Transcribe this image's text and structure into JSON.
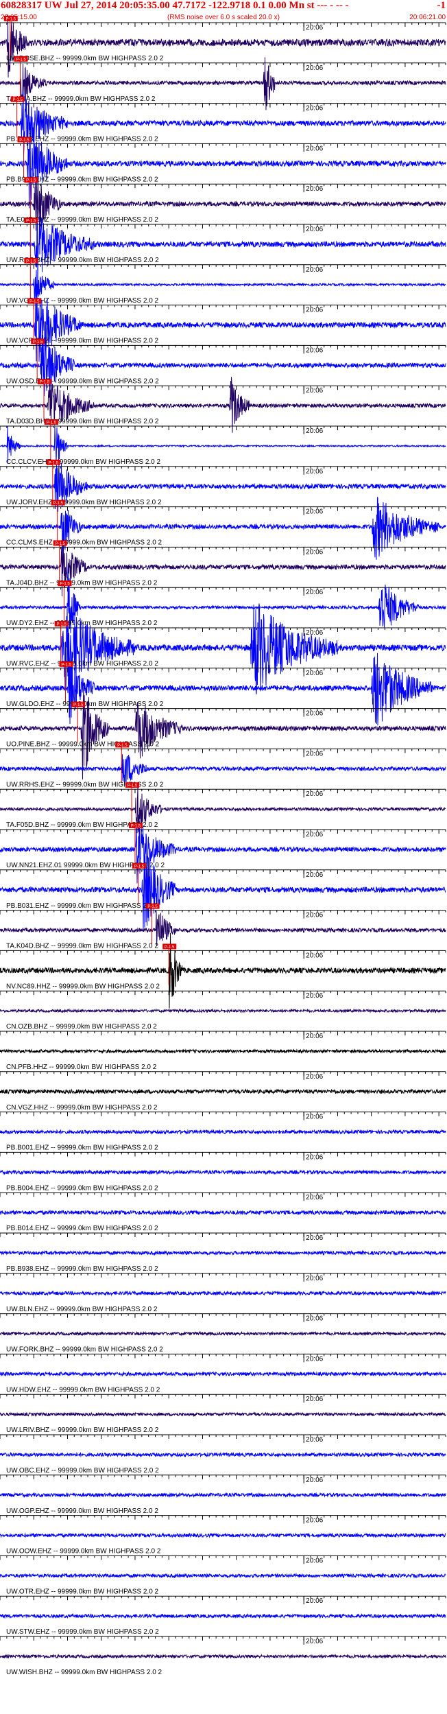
{
  "header": {
    "title": "60828317 UW Jul 27, 2014 20:05:35.00   47.7172 -122.9718  0.1 0.00 Mn st --- - -- -",
    "right": "-1",
    "start_time": "20:05:15.00",
    "note": "(RMS noise over 6.0 s scaled 20.0 x)",
    "end_time": "20:06:21.00"
  },
  "colors": {
    "header": "#e00000",
    "blue": "#0000ff",
    "navy": "#200060",
    "black": "#000000",
    "pick": "#e00000"
  },
  "chart_data": {
    "type": "seismogram",
    "x_start": "20:05:15.00",
    "x_end": "20:06:21.00",
    "x_range_s": [
      0,
      66
    ],
    "minute_marker_label": "20:06",
    "minute_marker_s": 45,
    "tick_interval_s": 1,
    "traces": [
      {
        "label": "UW.DOSE.BHZ -- 99999.0km BW  HIGHPASS  2.0  2",
        "color": "navy",
        "amp": 0.9,
        "pick_s": 1.5,
        "pick_label": "P-1.5",
        "burst": [
          1,
          4,
          1.1
        ]
      },
      {
        "label": "TA.I04A.BHZ -- 99999.0km BW  HIGHPASS  2.0  2",
        "color": "navy",
        "amp": 0.5,
        "pick_s": 3.0,
        "pick_label": "P-1.5",
        "burst": [
          3,
          7,
          0.6
        ],
        "burst2": [
          39,
          41,
          1.3
        ]
      },
      {
        "label": "PB.B013.EHZ -- 99999.0km BW  HIGHPASS  2.0  2",
        "color": "blue",
        "amp": 0.7,
        "pick_s": 2.5,
        "pick_label": "P-1.5",
        "burst": [
          3,
          10,
          1.0
        ]
      },
      {
        "label": "PB.B943.EHZ -- 99999.0km BW  HIGHPASS  2.0  2",
        "color": "blue",
        "amp": 0.7,
        "pick_s": 3.5,
        "pick_label": "P-1.5",
        "burst": [
          4,
          10,
          1.3
        ]
      },
      {
        "label": "TA.E04D.BHZ -- 99999.0km BW  HIGHPASS  2.0  2",
        "color": "navy",
        "amp": 0.6,
        "pick_s": 4.5,
        "pick_label": "P-1.5",
        "burst": [
          5,
          9,
          1.1
        ]
      },
      {
        "label": "UW.RGS.BHZ -- 99999.0km BW  HIGHPASS  2.0  2",
        "color": "blue",
        "amp": 0.7,
        "pick_s": 4.5,
        "pick_label": "P-1.5",
        "burst": [
          5,
          14,
          1.0
        ]
      },
      {
        "label": "UW.VGB.BHZ -- 99999.0km BW  HIGHPASS  2.0  2",
        "color": "blue",
        "amp": 0.3,
        "pick_s": 4.5,
        "pick_label": "P-1.5",
        "burst": [
          5,
          8,
          0.8
        ]
      },
      {
        "label": "UW.VCR.BHZ -- 99999.0km BW  HIGHPASS  2.0  2",
        "color": "blue",
        "amp": 0.7,
        "pick_s": 5.0,
        "pick_label": "P-1.5",
        "burst": [
          5,
          12,
          1.3
        ]
      },
      {
        "label": "UW.OSD.EHZ -- 99999.0km BW  HIGHPASS  2.0  2",
        "color": "blue",
        "amp": 0.6,
        "pick_s": 5.5,
        "pick_label": "P-1.5",
        "burst": [
          6,
          11,
          1.3
        ]
      },
      {
        "label": "TA.D03D.BHZ -- 99999.0km BW  HIGHPASS  2.0  2",
        "color": "navy",
        "amp": 0.5,
        "pick_s": 6.5,
        "pick_label": "P-1.5",
        "burst": [
          7,
          14,
          0.9
        ],
        "burst2": [
          34,
          37,
          1.0
        ]
      },
      {
        "label": "CC.CLCV.EHZ -- 99999.0km BW  HIGHPASS  2.0  2",
        "color": "blue",
        "amp": 0.2,
        "pick_s": 7.5,
        "pick_label": "P-1.5",
        "burst": [
          8,
          10,
          0.9
        ],
        "burst2": [
          1,
          3,
          0.6
        ]
      },
      {
        "label": "UW.JORV.EHZ -- 99999.0km BW  HIGHPASS  2.0  2",
        "color": "blue",
        "amp": 0.6,
        "pick_s": 7.8,
        "pick_label": "P-1.5",
        "burst": [
          8,
          13,
          1.0
        ]
      },
      {
        "label": "CC.CLMS.EHZ -- 99999.0km BW  HIGHPASS  2.0  2",
        "color": "blue",
        "amp": 0.6,
        "pick_s": 8.5,
        "pick_label": "P-1.5",
        "burst": [
          9,
          12,
          1.0
        ],
        "burst2": [
          55,
          65,
          1.0
        ]
      },
      {
        "label": "TA.J04D.BHZ -- 99999.0km BW  HIGHPASS  2.0  2",
        "color": "navy",
        "amp": 0.6,
        "pick_s": 8.8,
        "pick_label": "P-1.5",
        "burst": [
          9,
          13,
          0.9
        ]
      },
      {
        "label": "UW.DY2.EHZ -- 99999.0km BW  HIGHPASS  2.0  2",
        "color": "blue",
        "amp": 0.4,
        "pick_s": 9.5,
        "pick_label": "P-1.5",
        "burst": [
          10,
          12,
          1.2
        ],
        "burst2": [
          56,
          62,
          1.0
        ]
      },
      {
        "label": "UW.RVC.EHZ -- 99999.0km BW  HIGHPASS  2.0  2",
        "color": "blue",
        "amp": 0.8,
        "pick_s": 9.0,
        "pick_label": "P-1.5",
        "burst": [
          9,
          20,
          1.4
        ],
        "burst2": [
          37,
          50,
          1.5
        ]
      },
      {
        "label": "UW.GLDO.EHZ -- 99999.0km BW  HIGHPASS  2.0  2",
        "color": "blue",
        "amp": 0.7,
        "pick_s": 9.7,
        "pick_label": "P-1.5",
        "burst": [
          10,
          14,
          1.1
        ],
        "burst2": [
          55,
          64,
          1.3
        ]
      },
      {
        "label": "UO.PINE.BHZ -- 99999.0km BW  HIGHPASS  2.0  2",
        "color": "navy",
        "amp": 0.6,
        "pick_s": 11.5,
        "pick_label": "P-1.5",
        "burst": [
          12,
          16,
          1.6
        ],
        "burst2": [
          20,
          27,
          1.0
        ]
      },
      {
        "label": "UW.RRHS.EHZ -- 99999.0km BW  HIGHPASS  2.0  2",
        "color": "blue",
        "amp": 0.5,
        "pick_s": 18.0,
        "pick_label": "P-1.5",
        "burst": [
          18,
          22,
          0.7
        ]
      },
      {
        "label": "TA.F05D.BHZ -- 99999.0km BW  HIGHPASS  2.0  2",
        "color": "navy",
        "amp": 0.4,
        "pick_s": 19.5,
        "pick_label": "P-1.5",
        "burst": [
          20,
          24,
          0.8
        ]
      },
      {
        "label": "UW.NN21.EHZ.01 99999.0km BW  HIGHPASS  2.0  2",
        "color": "blue",
        "amp": 0.6,
        "pick_s": 20.0,
        "pick_label": "P-1.5",
        "burst": [
          20,
          26,
          1.0
        ]
      },
      {
        "label": "PB.B031.EHZ -- 99999.0km BW  HIGHPASS  2.0  2",
        "color": "blue",
        "amp": 0.7,
        "pick_s": 20.5,
        "pick_label": "P-1.5",
        "burst": [
          21,
          26,
          1.4
        ]
      },
      {
        "label": "TA.K04D.BHZ -- 99999.0km BW  HIGHPASS  2.0  2",
        "color": "navy",
        "amp": 0.5,
        "pick_s": 22.5,
        "pick_label": "P-1.5",
        "burst": [
          23,
          26,
          0.9
        ]
      },
      {
        "label": "NV.NC89.HHZ -- 99999.0km BW  HIGHPASS  2.0  2",
        "color": "black",
        "amp": 0.7,
        "pick_s": 25.0,
        "pick_label": "P-1.5",
        "burst": [
          25,
          27,
          1.5
        ]
      },
      {
        "label": "CN.OZB.BHZ -- 99999.0km BW  HIGHPASS  2.0  2",
        "color": "navy",
        "amp": 0.35
      },
      {
        "label": "CN.PFB.HHZ -- 99999.0km BW  HIGHPASS  2.0  2",
        "color": "black",
        "amp": 0.4
      },
      {
        "label": "CN.VGZ.HHZ -- 99999.0km BW  HIGHPASS  2.0  2",
        "color": "black",
        "amp": 0.5
      },
      {
        "label": "PB.B001.EHZ -- 99999.0km BW  HIGHPASS  2.0  2",
        "color": "blue",
        "amp": 0.45
      },
      {
        "label": "PB.B004.EHZ -- 99999.0km BW  HIGHPASS  2.0  2",
        "color": "blue",
        "amp": 0.45
      },
      {
        "label": "PB.B014.EHZ -- 99999.0km BW  HIGHPASS  2.0  2",
        "color": "blue",
        "amp": 0.5
      },
      {
        "label": "PB.B938.EHZ -- 99999.0km BW  HIGHPASS  2.0  2",
        "color": "blue",
        "amp": 0.45
      },
      {
        "label": "UW.BLN.EHZ -- 99999.0km BW  HIGHPASS  2.0  2",
        "color": "blue",
        "amp": 0.45
      },
      {
        "label": "UW.FORK.BHZ -- 99999.0km BW  HIGHPASS  2.0  2",
        "color": "navy",
        "amp": 0.4
      },
      {
        "label": "UW.HDW.EHZ -- 99999.0km BW  HIGHPASS  2.0  2",
        "color": "blue",
        "amp": 0.45
      },
      {
        "label": "UW.LRIV.BHZ -- 99999.0km BW  HIGHPASS  2.0  2",
        "color": "navy",
        "amp": 0.4
      },
      {
        "label": "UW.OBC.EHZ -- 99999.0km BW  HIGHPASS  2.0  2",
        "color": "blue",
        "amp": 0.45
      },
      {
        "label": "UW.OGP.EHZ -- 99999.0km BW  HIGHPASS  2.0  2",
        "color": "blue",
        "amp": 0.45
      },
      {
        "label": "UW.OOW.EHZ -- 99999.0km BW  HIGHPASS  2.0  2",
        "color": "blue",
        "amp": 0.45
      },
      {
        "label": "UW.OTR.EHZ -- 99999.0km BW  HIGHPASS  2.0  2",
        "color": "blue",
        "amp": 0.45
      },
      {
        "label": "UW.STW.EHZ -- 99999.0km BW  HIGHPASS  2.0  2",
        "color": "blue",
        "amp": 0.45
      },
      {
        "label": "UW.WISH.BHZ -- 99999.0km BW  HIGHPASS  2.0  2",
        "color": "navy",
        "amp": 0.4
      }
    ]
  }
}
